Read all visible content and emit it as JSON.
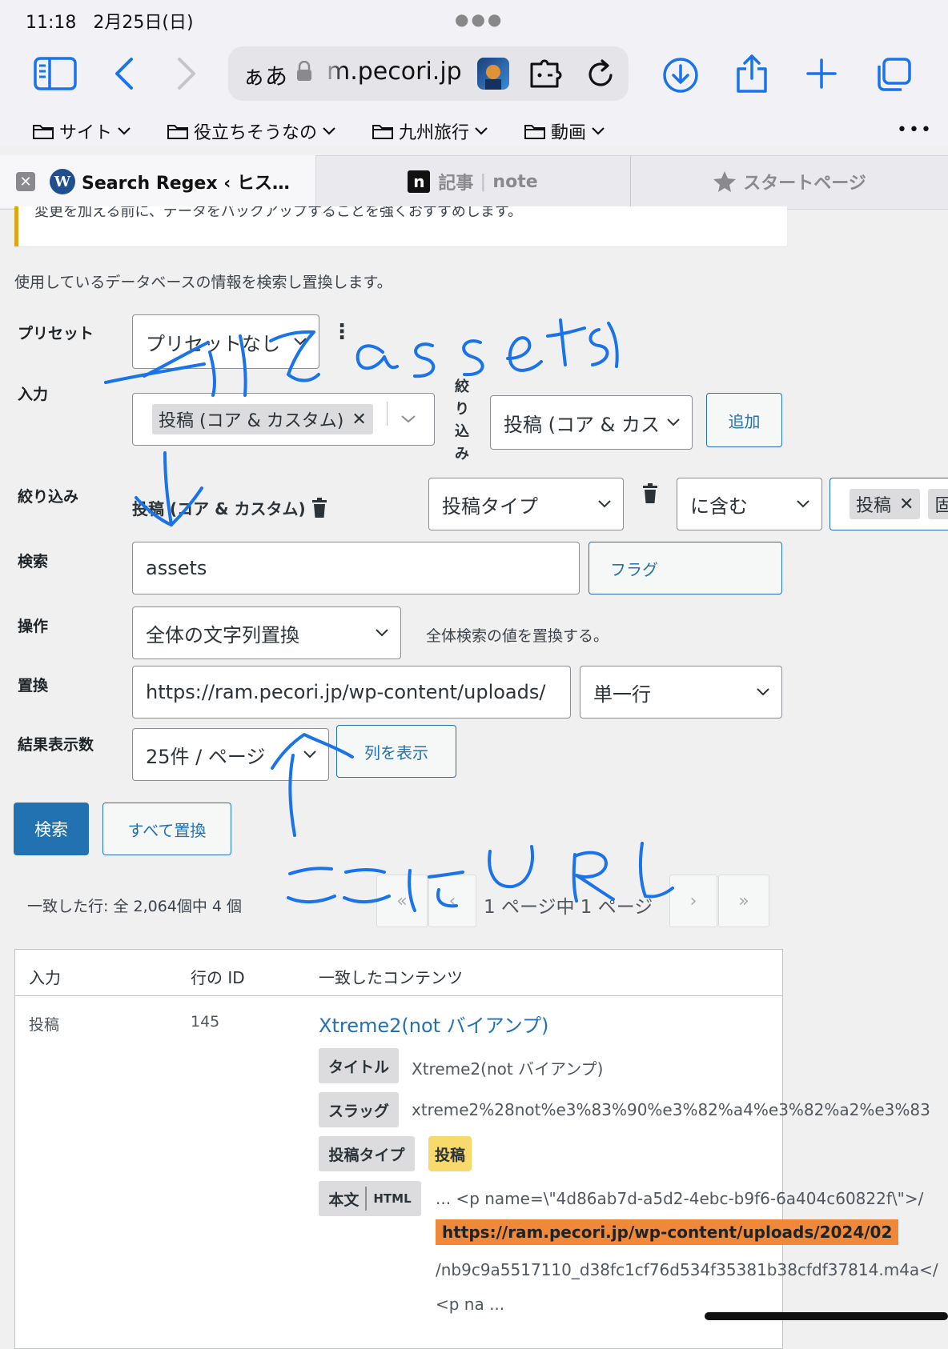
{
  "status": {
    "time": "11:18",
    "date": "2月25日(日)"
  },
  "browser": {
    "url_prefix": "ぁあ",
    "url": "m.pecori.jp",
    "bookmarks": [
      "サイト",
      "役立ちそうなの",
      "九州旅行",
      "動画"
    ],
    "tabs": [
      {
        "label": "Search Regex ‹ ヒス…"
      },
      {
        "label": "記事",
        "suffix": "note",
        "favicon": "n"
      },
      {
        "label": "スタートページ"
      }
    ]
  },
  "page": {
    "notice": "変更を加える前に、データをバックアップすることを強くおすすめします。",
    "description": "使用しているデータベースの情報を検索し置換します。",
    "preset": {
      "label": "プリセット",
      "value": "プリセットなし"
    },
    "source": {
      "label": "入力",
      "chip": "投稿 (コア & カスタム)",
      "filter_vertical": [
        "絞",
        "り",
        "込",
        "み"
      ],
      "filter_select": "投稿 (コア & カス",
      "add_button": "追加"
    },
    "filter": {
      "label": "絞り込み",
      "source_name": "投稿 (コア & カスタム)",
      "column_select": "投稿タイプ",
      "logic_select": "に含む",
      "chips": [
        "投稿",
        "固"
      ]
    },
    "search": {
      "label": "検索",
      "value": "assets",
      "flags_button": "フラグ"
    },
    "action": {
      "label": "操作",
      "value": "全体の文字列置換",
      "hint": "全体検索の値を置換する。"
    },
    "replace": {
      "label": "置換",
      "value": "https://ram.pecori.jp/wp-content/uploads/",
      "mode": "単一行"
    },
    "per_page": {
      "label": "結果表示数",
      "value": "25件 / ページ",
      "columns_button": "列を表示"
    },
    "buttons": {
      "search": "検索",
      "replace_all": "すべて置換"
    },
    "results": {
      "summary": "一致した行: 全 2,064個中 4 個",
      "pager": {
        "first": "«",
        "prev": "‹",
        "text": "1 ページ中 1 ページ",
        "next": "›",
        "last": "»"
      },
      "headers": [
        "入力",
        "行の ID",
        "一致したコンテンツ"
      ],
      "row": {
        "source": "投稿",
        "id": "145",
        "title_link": "Xtreme2(not バイアンプ)",
        "fields": {
          "title_label": "タイトル",
          "title_value": "Xtreme2(not バイアンプ)",
          "slug_label": "スラッグ",
          "slug_value": "xtreme2%28not%e3%83%90%e3%82%a4%e3%82%a2%e3%83",
          "type_label": "投稿タイプ",
          "type_value": "投稿",
          "content_label": "本文",
          "content_format": "HTML",
          "content_line1": "... <p name=\\\"4d86ab7d-a5d2-4ebc-b9f6-6a404c60822f\\\">/",
          "content_highlight": "https://ram.pecori.jp/wp-content/uploads/2024/02",
          "content_line3": "/nb9c9a5517110_d38fc1cf76d534f35381b38cfdf37814.m4a</",
          "content_line4": "<p na ..."
        }
      }
    }
  },
  "colors": {
    "accent": "#2271b1",
    "highlight": "#f0883a",
    "badge": "#f8d96b",
    "ink": "#1a73e8"
  }
}
